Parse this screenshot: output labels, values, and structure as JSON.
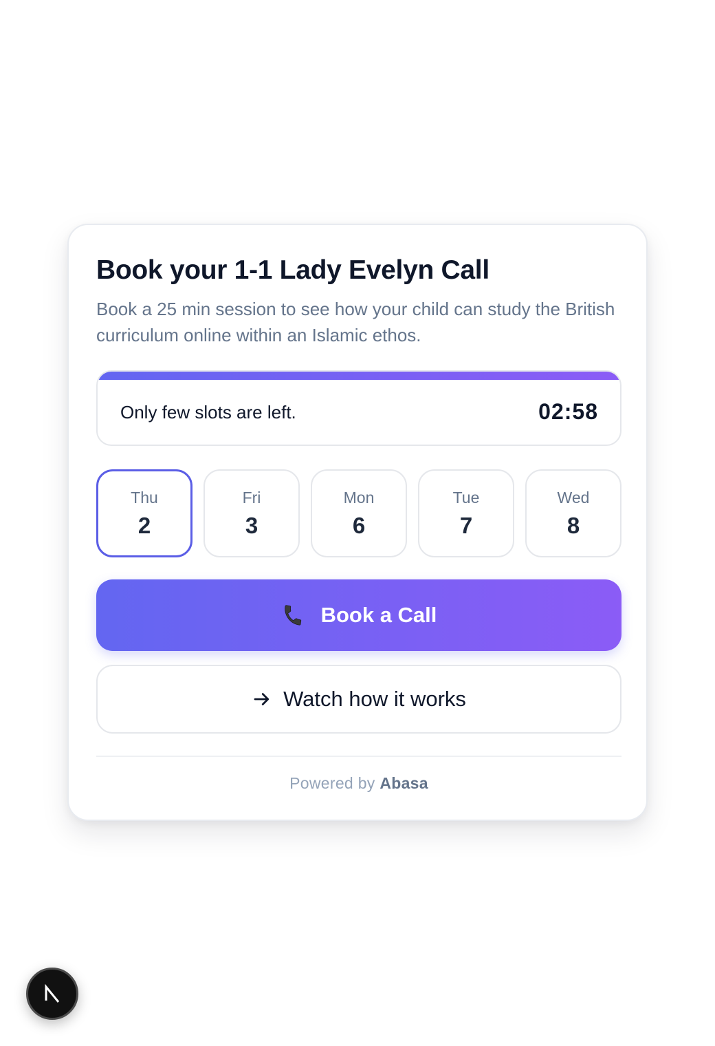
{
  "card": {
    "title": "Book your 1-1 Lady Evelyn Call",
    "subtitle": "Book a 25 min session to see how your child can study the British curriculum online within an Islamic ethos."
  },
  "alert": {
    "message": "Only few slots are left.",
    "timer": "02:58",
    "bar_progress_percent": 100
  },
  "days": [
    {
      "name": "Thu",
      "number": "2",
      "selected": true
    },
    {
      "name": "Fri",
      "number": "3",
      "selected": false
    },
    {
      "name": "Mon",
      "number": "6",
      "selected": false
    },
    {
      "name": "Tue",
      "number": "7",
      "selected": false
    },
    {
      "name": "Wed",
      "number": "8",
      "selected": false
    }
  ],
  "primary_button": {
    "label": "Book a Call",
    "icon": "phone-icon"
  },
  "secondary_button": {
    "label": "Watch how it works",
    "icon": "arrow-right-icon"
  },
  "footer": {
    "prefix": "Powered by",
    "brand": "Abasa"
  },
  "badge": {
    "letter": "N",
    "icon": "nextjs-logo-icon"
  },
  "colors": {
    "accent_start": "#6366f1",
    "accent_end": "#8b5cf6",
    "title": "#0f172a",
    "muted": "#64748b",
    "border": "#e5e7eb"
  }
}
